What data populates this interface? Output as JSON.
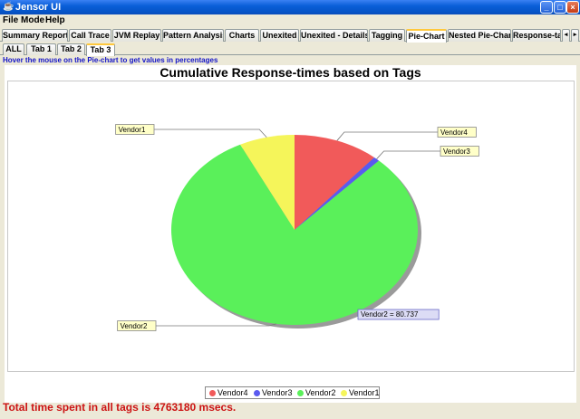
{
  "window": {
    "title": "Jensor UI"
  },
  "menu": {
    "file": "File",
    "mode": "Mode",
    "help": "Help"
  },
  "tabs": [
    {
      "label": "Summary Report"
    },
    {
      "label": "Call Trace"
    },
    {
      "label": "JVM Replay"
    },
    {
      "label": "Pattern Analysis"
    },
    {
      "label": "Charts"
    },
    {
      "label": "Unexited"
    },
    {
      "label": "Unexited - Details"
    },
    {
      "label": "Tagging"
    },
    {
      "label": "Pie-Chart",
      "selected": true
    },
    {
      "label": "Nested Pie-Chart"
    },
    {
      "label": "Response-ta"
    }
  ],
  "subtabs": [
    {
      "label": "ALL"
    },
    {
      "label": "Tab 1"
    },
    {
      "label": "Tab 2"
    },
    {
      "label": "Tab 3",
      "selected": true
    }
  ],
  "hint": "Hover the mouse on the Pie-chart to get values in percentages",
  "chart_data": {
    "type": "pie",
    "title": "Cumulative Response-times based on Tags",
    "slices": [
      {
        "name": "Vendor4",
        "value": 11.2,
        "color": "#f15a5a"
      },
      {
        "name": "Vendor3",
        "value": 0.8,
        "color": "#5a5af0"
      },
      {
        "name": "Vendor2",
        "value": 80.737,
        "color": "#5af05a"
      },
      {
        "name": "Vendor1",
        "value": 7.263,
        "color": "#f5f55a"
      }
    ],
    "tooltip": "Vendor2 = 80.737",
    "legend": [
      "Vendor4",
      "Vendor3",
      "Vendor2",
      "Vendor1"
    ],
    "legend_position": "bottom"
  },
  "footer": {
    "total": "Total time spent in all tags is 4763180 msecs."
  }
}
